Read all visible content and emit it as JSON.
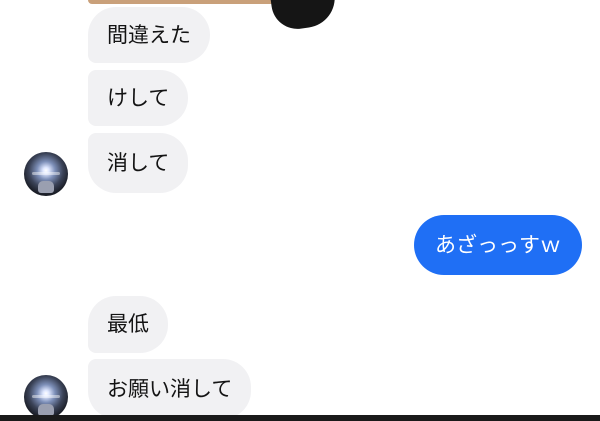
{
  "conversation": {
    "messages": [
      {
        "direction": "incoming",
        "text": "間違えた"
      },
      {
        "direction": "incoming",
        "text": "けして"
      },
      {
        "direction": "incoming",
        "text": "消して"
      },
      {
        "direction": "outgoing",
        "text": "あざっっすｗ"
      },
      {
        "direction": "incoming",
        "text": "最低"
      },
      {
        "direction": "incoming",
        "text": "お願い消して"
      }
    ]
  },
  "colors": {
    "incoming_bubble": "#f1f1f3",
    "outgoing_bubble": "#1f6ff5",
    "incoming_text": "#141414",
    "outgoing_text": "#ffffff"
  }
}
